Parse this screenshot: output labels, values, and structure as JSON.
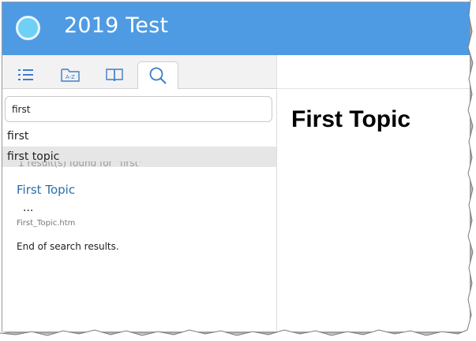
{
  "header": {
    "title": "2019 Test",
    "logo_icon": "circle-logo-icon",
    "accent_color": "#4f9be3"
  },
  "sidebar": {
    "tabs": [
      {
        "icon": "list-icon",
        "name": "toc"
      },
      {
        "icon": "a-z-folder-icon",
        "name": "index",
        "text": "A-Z"
      },
      {
        "icon": "book-icon",
        "name": "glossary"
      },
      {
        "icon": "search-icon",
        "name": "search",
        "active": true
      }
    ],
    "search": {
      "value": "first"
    },
    "suggestions": [
      "first",
      "first topic"
    ],
    "results": {
      "summary": "1 result(s) found for \"first\"",
      "items": [
        {
          "title": "First Topic",
          "snippet": "...",
          "file": "First_Topic.htm"
        }
      ],
      "end_text": "End of search results."
    }
  },
  "content": {
    "page_title": "First Topic"
  }
}
